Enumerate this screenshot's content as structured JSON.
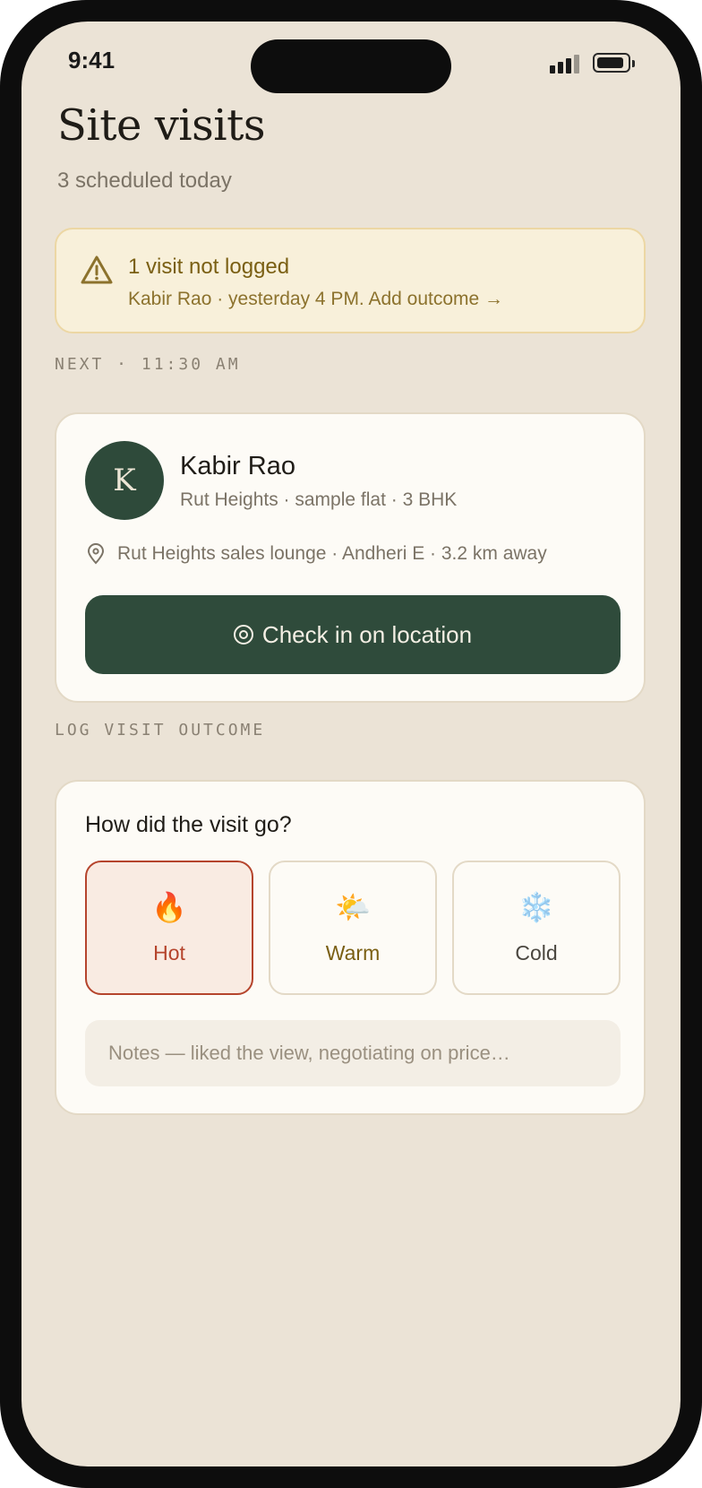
{
  "status_bar": {
    "time": "9:41"
  },
  "header": {
    "title": "Site visits",
    "subtitle": "3 scheduled today"
  },
  "alert": {
    "icon": "warning-icon",
    "title": "1 visit not logged",
    "detail": "Kabir Rao · yesterday 4 PM. Add outcome →"
  },
  "next_visit": {
    "section_label": "NEXT · 11:30 AM",
    "avatar_initial": "K",
    "name": "Kabir Rao",
    "meta": "Rut Heights · sample flat · 3 BHK",
    "location": "Rut Heights sales lounge · Andheri E · 3.2 km away",
    "checkin_label": "Check in on location"
  },
  "outcome": {
    "section_label": "LOG VISIT OUTCOME",
    "question": "How did the visit go?",
    "options": [
      {
        "label": "Hot",
        "icon": "🔥",
        "selected": true,
        "color": "#b5442c"
      },
      {
        "label": "Warm",
        "icon": "🌤️",
        "selected": false,
        "color": "#7a5f13"
      },
      {
        "label": "Cold",
        "icon": "❄️",
        "selected": false,
        "color": "#4a463f"
      }
    ],
    "notes_placeholder": "Notes — liked the view, negotiating on price…"
  },
  "colors": {
    "background": "#ebe3d6",
    "accent_green": "#2f4b3b",
    "alert_bg": "#f8f0da",
    "alert_text": "#7a5f13",
    "hot": "#b5442c"
  }
}
